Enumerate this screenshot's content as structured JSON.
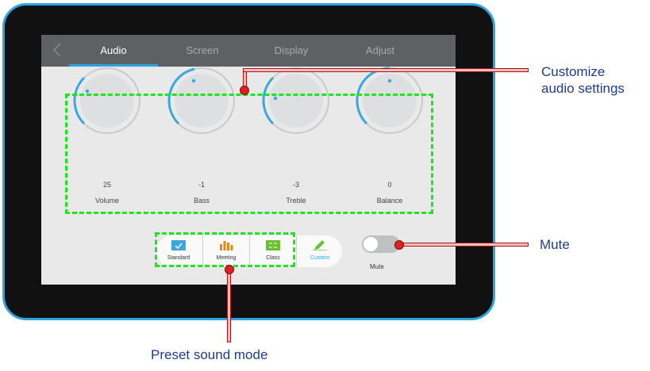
{
  "tabs": [
    {
      "label": "Audio",
      "active": true
    },
    {
      "label": "Screen",
      "active": false
    },
    {
      "label": "Display",
      "active": false
    },
    {
      "label": "Adjust",
      "active": false
    }
  ],
  "knobs": [
    {
      "label": "Volume",
      "value": "25"
    },
    {
      "label": "Bass",
      "value": "-1"
    },
    {
      "label": "Treble",
      "value": "-3"
    },
    {
      "label": "Balance",
      "value": "0"
    }
  ],
  "sound_modes": [
    {
      "label": "Standard",
      "icon": "screen-check-icon",
      "color": "#3aa7e0"
    },
    {
      "label": "Meeting",
      "icon": "bar-chart-icon",
      "color": "#e08a1e"
    },
    {
      "label": "Class",
      "icon": "board-icon",
      "color": "#6cc030"
    },
    {
      "label": "Custom",
      "icon": "edit-icon",
      "color": "#6cc030"
    }
  ],
  "mute": {
    "label": "Mute",
    "on": false
  },
  "callouts": {
    "customize": "Customize\naudio settings",
    "mute": "Mute",
    "preset": "Preset sound mode"
  },
  "colors": {
    "accent": "#2ea3e0",
    "highlight": "#1ee51e",
    "callout_text": "#1f3b8c",
    "marker": "#e02020"
  }
}
